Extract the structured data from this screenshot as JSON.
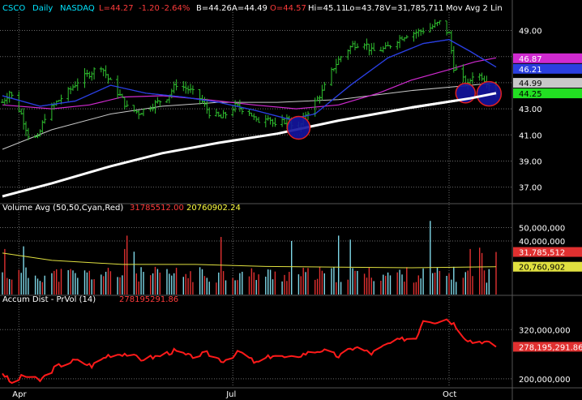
{
  "header": {
    "symbol": "CSCO",
    "period": "Daily",
    "exchange": "NASDAQ",
    "last": "L=44.27",
    "change": "-1.20",
    "change_pct": "-2.64%",
    "bid": "B=44.26",
    "ask": "A=44.49",
    "open": "O=44.57",
    "high": "Hi=45.11",
    "low": "Lo=43.78",
    "volume": "V=31,785,711",
    "study": "Mov Avg 2 Lin"
  },
  "colors": {
    "background": "#000000",
    "bar": "#2fbf2f",
    "ma_blue": "#2a3fe0",
    "ma_magenta": "#d02ad0",
    "ma_gray": "#c8c8c8",
    "ma_white": "#ffffff",
    "volume_up": "#7fd8e8",
    "volume_down": "#e03030",
    "volume_avg": "#e0e040",
    "accum": "#ff1a1a",
    "circle_fill": "#1414a0",
    "circle_stroke": "#e02020",
    "grid": "#6a6a6a",
    "axis_text": "#ffffff"
  },
  "price_panel": {
    "ticks": [
      "49.00",
      "47.00",
      "45.00",
      "43.00",
      "41.00",
      "39.00",
      "37.00"
    ],
    "ylim": [
      35.8,
      50.4
    ],
    "badges": [
      {
        "label": "46.87",
        "bg": "#d02ad0",
        "fg": "#ffffff",
        "value": 46.87
      },
      {
        "label": "46.21",
        "bg": "#2a3fe0",
        "fg": "#ffffff",
        "value": 46.21
      },
      {
        "label": "44.99",
        "bg": "#c8c8c8",
        "fg": "#000000",
        "value": 44.99
      },
      {
        "label": "44.25",
        "bg": "#22e022",
        "fg": "#000000",
        "value": 44.25
      }
    ],
    "circles": [
      {
        "date": "2019-07-29",
        "price": 41.55
      },
      {
        "date": "2019-10-08",
        "price": 44.2
      },
      {
        "date": "2019-10-18",
        "price": 44.15
      }
    ]
  },
  "volume_panel": {
    "title": "Volume Avg (50,50,Cyan,Red)",
    "value1": "31785512.00",
    "value2": "20760902.24",
    "ticks": [
      "50,000,000",
      "40,000,000"
    ],
    "badges": [
      {
        "label": "31,785,512",
        "bg": "#e03030",
        "fg": "#ffffff",
        "value": 31785512
      },
      {
        "label": "20,760,902",
        "bg": "#e0e040",
        "fg": "#000000",
        "value": 20760902
      }
    ]
  },
  "accum_panel": {
    "title": "Accum Dist - PrVol (14)",
    "value": "278195291.86",
    "ticks": [
      "320,000,000",
      "200,000,000"
    ],
    "badge": {
      "label": "278,195,291.86",
      "bg": "#e03030",
      "fg": "#ffffff",
      "value": 278195291.86
    }
  },
  "x_axis": {
    "labels": [
      {
        "label": "Apr",
        "date": "2019-04-01"
      },
      {
        "label": "Jul",
        "date": "2019-07-01"
      },
      {
        "label": "Oct",
        "date": "2019-10-01"
      }
    ]
  },
  "chart_data": [
    {
      "type": "ohlc",
      "title": "CSCO Daily NASDAQ",
      "x_range": [
        "2019-03-25",
        "2019-10-21"
      ],
      "ylim": [
        35.8,
        50.4
      ],
      "close_path": [
        [
          "2019-03-25",
          43.5
        ],
        [
          "2019-03-28",
          44.3
        ],
        [
          "2019-04-02",
          42.6
        ],
        [
          "2019-04-05",
          41.0
        ],
        [
          "2019-04-09",
          40.7
        ],
        [
          "2019-04-12",
          42.4
        ],
        [
          "2019-04-17",
          43.5
        ],
        [
          "2019-04-22",
          44.3
        ],
        [
          "2019-04-26",
          45.1
        ],
        [
          "2019-05-01",
          45.7
        ],
        [
          "2019-05-06",
          46.3
        ],
        [
          "2019-05-09",
          45.3
        ],
        [
          "2019-05-14",
          44.0
        ],
        [
          "2019-05-17",
          43.1
        ],
        [
          "2019-05-22",
          42.7
        ],
        [
          "2019-05-28",
          43.3
        ],
        [
          "2019-06-03",
          43.9
        ],
        [
          "2019-06-07",
          44.9
        ],
        [
          "2019-06-12",
          44.5
        ],
        [
          "2019-06-17",
          43.8
        ],
        [
          "2019-06-21",
          42.7
        ],
        [
          "2019-06-26",
          42.3
        ],
        [
          "2019-07-02",
          43.2
        ],
        [
          "2019-07-08",
          42.8
        ],
        [
          "2019-07-11",
          42.0
        ],
        [
          "2019-07-16",
          42.5
        ],
        [
          "2019-07-19",
          41.6
        ],
        [
          "2019-07-24",
          42.2
        ],
        [
          "2019-07-29",
          41.4
        ],
        [
          "2019-08-01",
          42.6
        ],
        [
          "2019-08-05",
          43.5
        ],
        [
          "2019-08-08",
          44.3
        ],
        [
          "2019-08-13",
          46.2
        ],
        [
          "2019-08-16",
          47.0
        ],
        [
          "2019-08-21",
          47.9
        ],
        [
          "2019-08-26",
          48.1
        ],
        [
          "2019-08-29",
          47.4
        ],
        [
          "2019-09-04",
          47.6
        ],
        [
          "2019-09-09",
          48.3
        ],
        [
          "2019-09-13",
          48.7
        ],
        [
          "2019-09-18",
          48.9
        ],
        [
          "2019-09-23",
          49.2
        ],
        [
          "2019-09-27",
          49.6
        ],
        [
          "2019-10-01",
          48.7
        ],
        [
          "2019-10-03",
          46.2
        ],
        [
          "2019-10-07",
          45.2
        ],
        [
          "2019-10-09",
          44.8
        ],
        [
          "2019-10-11",
          45.6
        ],
        [
          "2019-10-15",
          45.5
        ],
        [
          "2019-10-17",
          45.1
        ],
        [
          "2019-10-21",
          44.3
        ]
      ],
      "series": [
        {
          "name": "Mov Avg (blue)",
          "points": [
            [
              "2019-03-25",
              44.0
            ],
            [
              "2019-04-10",
              43.2
            ],
            [
              "2019-04-25",
              43.6
            ],
            [
              "2019-05-10",
              44.8
            ],
            [
              "2019-05-25",
              44.2
            ],
            [
              "2019-06-10",
              43.9
            ],
            [
              "2019-06-25",
              43.5
            ],
            [
              "2019-07-10",
              42.9
            ],
            [
              "2019-07-25",
              42.2
            ],
            [
              "2019-08-05",
              42.6
            ],
            [
              "2019-08-20",
              44.8
            ],
            [
              "2019-09-05",
              46.9
            ],
            [
              "2019-09-20",
              48.0
            ],
            [
              "2019-10-01",
              48.3
            ],
            [
              "2019-10-10",
              47.4
            ],
            [
              "2019-10-21",
              46.2
            ]
          ]
        },
        {
          "name": "Mov Avg (magenta)",
          "points": [
            [
              "2019-03-25",
              43.3
            ],
            [
              "2019-04-15",
              43.0
            ],
            [
              "2019-05-01",
              43.3
            ],
            [
              "2019-05-15",
              43.9
            ],
            [
              "2019-06-01",
              44.0
            ],
            [
              "2019-06-20",
              43.7
            ],
            [
              "2019-07-10",
              43.3
            ],
            [
              "2019-07-28",
              43.0
            ],
            [
              "2019-08-15",
              43.3
            ],
            [
              "2019-09-01",
              44.2
            ],
            [
              "2019-09-15",
              45.2
            ],
            [
              "2019-10-01",
              46.0
            ],
            [
              "2019-10-12",
              46.6
            ],
            [
              "2019-10-21",
              46.9
            ]
          ]
        },
        {
          "name": "Mov Avg (gray)",
          "points": [
            [
              "2019-03-25",
              39.9
            ],
            [
              "2019-04-15",
              41.4
            ],
            [
              "2019-05-10",
              42.6
            ],
            [
              "2019-06-01",
              43.2
            ],
            [
              "2019-06-25",
              43.5
            ],
            [
              "2019-07-20",
              43.5
            ],
            [
              "2019-08-15",
              43.7
            ],
            [
              "2019-09-15",
              44.4
            ],
            [
              "2019-10-10",
              44.8
            ],
            [
              "2019-10-21",
              45.0
            ]
          ]
        },
        {
          "name": "Mov Avg (white)",
          "points": [
            [
              "2019-03-25",
              36.3
            ],
            [
              "2019-04-15",
              37.3
            ],
            [
              "2019-05-10",
              38.6
            ],
            [
              "2019-06-01",
              39.6
            ],
            [
              "2019-06-25",
              40.4
            ],
            [
              "2019-07-20",
              41.1
            ],
            [
              "2019-08-15",
              42.1
            ],
            [
              "2019-09-15",
              43.1
            ],
            [
              "2019-10-10",
              43.8
            ],
            [
              "2019-10-21",
              44.2
            ]
          ]
        }
      ]
    },
    {
      "type": "bar",
      "title": "Volume Avg (50,50,Cyan,Red)",
      "ylim": [
        0,
        60000000
      ],
      "baseline_volume": 16000000,
      "spikes": [
        {
          "date": "2019-03-26",
          "value": 34000000,
          "color": "down"
        },
        {
          "date": "2019-04-03",
          "value": 36000000,
          "color": "up"
        },
        {
          "date": "2019-05-16",
          "value": 34000000,
          "color": "down"
        },
        {
          "date": "2019-05-17",
          "value": 44000000,
          "color": "down"
        },
        {
          "date": "2019-05-20",
          "value": 32000000,
          "color": "up"
        },
        {
          "date": "2019-06-26",
          "value": 43000000,
          "color": "down"
        },
        {
          "date": "2019-07-26",
          "value": 40000000,
          "color": "up"
        },
        {
          "date": "2019-08-15",
          "value": 44000000,
          "color": "up"
        },
        {
          "date": "2019-08-20",
          "value": 41000000,
          "color": "up"
        },
        {
          "date": "2019-09-23",
          "value": 55000000,
          "color": "up"
        },
        {
          "date": "2019-10-10",
          "value": 34000000,
          "color": "down"
        },
        {
          "date": "2019-10-14",
          "value": 35000000,
          "color": "down"
        },
        {
          "date": "2019-10-15",
          "value": 31000000,
          "color": "down"
        },
        {
          "date": "2019-10-21",
          "value": 31785512,
          "color": "down"
        }
      ],
      "avg_points": [
        [
          "2019-03-25",
          31000000
        ],
        [
          "2019-04-15",
          25500000
        ],
        [
          "2019-05-15",
          22500000
        ],
        [
          "2019-06-15",
          22500000
        ],
        [
          "2019-07-15",
          21000000
        ],
        [
          "2019-08-15",
          20500000
        ],
        [
          "2019-09-15",
          20000000
        ],
        [
          "2019-10-21",
          20760902
        ]
      ]
    },
    {
      "type": "line",
      "title": "Accum Dist - PrVol (14)",
      "ylim": [
        180000000,
        380000000
      ],
      "points": [
        [
          "2019-03-25",
          215000000
        ],
        [
          "2019-03-29",
          188000000
        ],
        [
          "2019-04-03",
          208000000
        ],
        [
          "2019-04-10",
          196000000
        ],
        [
          "2019-04-17",
          230000000
        ],
        [
          "2019-04-25",
          245000000
        ],
        [
          "2019-05-02",
          232000000
        ],
        [
          "2019-05-09",
          258000000
        ],
        [
          "2019-05-16",
          262000000
        ],
        [
          "2019-05-23",
          248000000
        ],
        [
          "2019-05-30",
          255000000
        ],
        [
          "2019-06-06",
          268000000
        ],
        [
          "2019-06-13",
          254000000
        ],
        [
          "2019-06-20",
          262000000
        ],
        [
          "2019-06-27",
          244000000
        ],
        [
          "2019-07-04",
          266000000
        ],
        [
          "2019-07-11",
          238000000
        ],
        [
          "2019-07-18",
          258000000
        ],
        [
          "2019-07-25",
          250000000
        ],
        [
          "2019-08-01",
          262000000
        ],
        [
          "2019-08-08",
          270000000
        ],
        [
          "2019-08-15",
          255000000
        ],
        [
          "2019-08-22",
          278000000
        ],
        [
          "2019-08-29",
          262000000
        ],
        [
          "2019-09-05",
          285000000
        ],
        [
          "2019-09-12",
          298000000
        ],
        [
          "2019-09-17",
          300000000
        ],
        [
          "2019-09-20",
          345000000
        ],
        [
          "2019-09-25",
          340000000
        ],
        [
          "2019-09-30",
          346000000
        ],
        [
          "2019-10-03",
          335000000
        ],
        [
          "2019-10-08",
          300000000
        ],
        [
          "2019-10-11",
          290000000
        ],
        [
          "2019-10-15",
          292000000
        ],
        [
          "2019-10-18",
          286000000
        ],
        [
          "2019-10-21",
          278195291.86
        ]
      ]
    }
  ]
}
